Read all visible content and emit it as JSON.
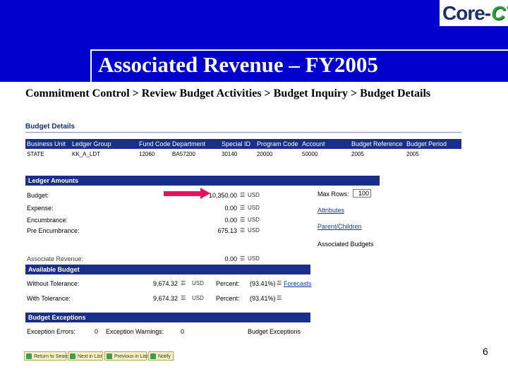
{
  "slide": {
    "title": "Associated Revenue – FY2005",
    "breadcrumb": "Commitment Control > Review Budget Activities > Budget Inquiry > Budget Details",
    "page_number": "6",
    "logo": {
      "left": "Core-",
      "right": "CT"
    },
    "colors": {
      "banner": "#0000cc",
      "arrow": "#e6135c",
      "header_bar": "#1a2f8a"
    }
  },
  "budget_details": {
    "section_title": "Budget Details",
    "columns": [
      "Business Unit",
      "Ledger Group",
      "Fund Code",
      "Department",
      "Special ID",
      "Program Code",
      "Account",
      "Budget Reference",
      "Budget Period"
    ],
    "row": [
      "STATE",
      "KK_A_LDT",
      "12060",
      "BA57200",
      "30140",
      "20000",
      "50000",
      "2005",
      "2005"
    ]
  },
  "ledger_amounts": {
    "title": "Ledger Amounts",
    "rows": [
      {
        "label": "Budget:",
        "value": "10,350.00",
        "currency": "USD"
      },
      {
        "label": "Expense:",
        "value": "0.00",
        "currency": "USD"
      },
      {
        "label": "Encumbrance:",
        "value": "0.00",
        "currency": "USD"
      },
      {
        "label": "Pre Encumbrance:",
        "value": "675.13",
        "currency": "USD"
      }
    ],
    "associate_revenue": {
      "label": "Associate Revenue:",
      "value": "0.00",
      "currency": "USD"
    },
    "max_rows_label": "Max Rows:",
    "max_rows_value": "100",
    "links": {
      "attributes": "Attributes",
      "parent_children": "Parent/Children"
    },
    "associated_budgets": "Associated Budgets"
  },
  "available_budget": {
    "title": "Available Budget",
    "rows": [
      {
        "label": "Without Tolerance:",
        "value": "9,674.32",
        "currency": "USD",
        "percent_label": "Percent:",
        "percent": "(93.41%)",
        "link": "Forecasts"
      },
      {
        "label": "With Tolerance:",
        "value": "9,674.32",
        "currency": "USD",
        "percent_label": "Percent:",
        "percent": "(93.41%)"
      }
    ]
  },
  "budget_exceptions": {
    "title": "Budget Exceptions",
    "errors_label": "Exception Errors:",
    "errors_value": "0",
    "warnings_label": "Exception Warnings:",
    "warnings_value": "0",
    "link": "Budget Exceptions"
  },
  "buttons": [
    "Return to Search",
    "Next in List",
    "Previous in List",
    "Notify"
  ]
}
